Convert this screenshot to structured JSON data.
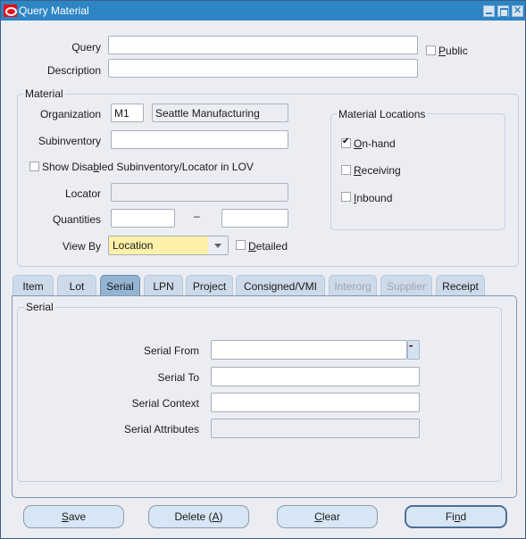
{
  "window": {
    "title": "Query Material",
    "controls": {
      "minimize": "minimize-icon",
      "maximize": "maximize-icon",
      "close": "✕"
    }
  },
  "header": {
    "query_label": "Query",
    "query_value": "",
    "description_label": "Description",
    "description_value": "",
    "public_label_u": "P",
    "public_label_rest": "ublic",
    "public_checked": false
  },
  "material": {
    "group_title": "Material",
    "organization_label": "Organization",
    "organization_code": "M1",
    "organization_name": "Seattle Manufacturing",
    "subinventory_label": "Subinventory",
    "subinventory_value": "",
    "show_disabled_pre": "Show Disa",
    "show_disabled_u": "b",
    "show_disabled_post": "led Subinventory/Locator in LOV",
    "show_disabled_checked": false,
    "locator_label": "Locator",
    "locator_value": "",
    "quantities_label": "Quantities",
    "quantity_from": "",
    "quantity_separator": "–",
    "quantity_to": "",
    "view_by_label": "View By",
    "view_by_value": "Location",
    "detailed_u": "D",
    "detailed_rest": "etailed",
    "detailed_checked": false
  },
  "locations": {
    "group_title": "Material Locations",
    "items": [
      {
        "u": "O",
        "rest": "n-hand",
        "checked": true
      },
      {
        "u": "R",
        "rest": "eceiving",
        "checked": false
      },
      {
        "u": "I",
        "rest": "nbound",
        "checked": false
      }
    ]
  },
  "tabs": [
    {
      "label": "Item",
      "state": "normal"
    },
    {
      "label": "Lot",
      "state": "normal"
    },
    {
      "label": "Serial",
      "state": "active"
    },
    {
      "label": "LPN",
      "state": "normal"
    },
    {
      "label": "Project",
      "state": "normal"
    },
    {
      "label": "Consigned/VMI",
      "state": "normal"
    },
    {
      "label": "Interorg",
      "state": "disabled"
    },
    {
      "label": "Supplier",
      "state": "disabled"
    },
    {
      "label": "Receipt",
      "state": "normal"
    }
  ],
  "serial": {
    "group_title": "Serial",
    "serial_from_label": "Serial From",
    "serial_from_value": "",
    "serial_to_label": "Serial To",
    "serial_to_value": "",
    "serial_context_label": "Serial Context",
    "serial_context_value": "",
    "serial_attributes_label": "Serial Attributes",
    "serial_attributes_value": ""
  },
  "buttons": {
    "save_u": "S",
    "save_rest": "ave",
    "delete_pre": "Delete (",
    "delete_u": "A",
    "delete_post": ")",
    "clear_u": "C",
    "clear_rest": "lear",
    "find_pre": "Fi",
    "find_u": "n",
    "find_post": "d"
  }
}
